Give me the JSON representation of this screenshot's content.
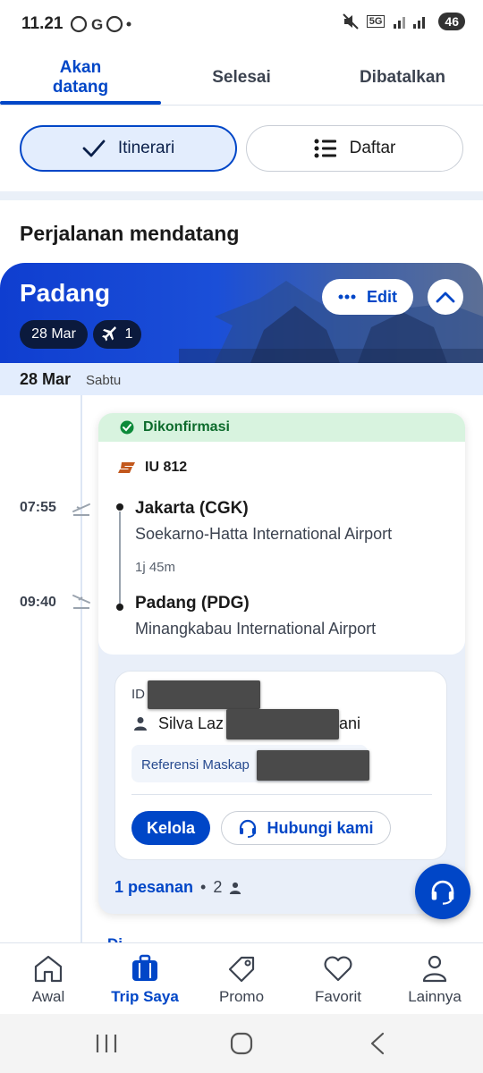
{
  "status_bar": {
    "time": "11.21",
    "left_icons": "ⓦ G ◎ •",
    "network": "5G",
    "battery": "46"
  },
  "tabs": [
    {
      "label": "Akan datang"
    },
    {
      "label": "Selesai"
    },
    {
      "label": "Dibatalkan"
    }
  ],
  "view_toggle": {
    "itinerary_label": "Itinerari",
    "list_label": "Daftar"
  },
  "section_title": "Perjalanan mendatang",
  "trip": {
    "destination": "Padang",
    "date_chip": "28 Mar",
    "flight_count": "1",
    "edit_label": "Edit",
    "date_main": "28 Mar",
    "date_day": "Sabtu"
  },
  "flight": {
    "status": "Dikonfirmasi",
    "number": "IU 812",
    "departure_time": "07:55",
    "arrival_time": "09:40",
    "origin_city": "Jakarta (CGK)",
    "origin_airport": "Soekarno-Hatta International Airport",
    "duration": "1j 45m",
    "dest_city": "Padang (PDG)",
    "dest_airport": "Minangkabau International Airport"
  },
  "booking": {
    "id_label": "ID",
    "passenger_visible": "Silva Laz",
    "passenger_suffix": "ani",
    "airline_ref_label": "Referensi Maskap",
    "manage_label": "Kelola",
    "contact_label": "Hubungi kami",
    "orders_label": "1 pesanan",
    "separator": "•",
    "pax_count": "2"
  },
  "peek_text": "Di...",
  "bottom_nav": [
    {
      "label": "Awal",
      "icon": "home-icon"
    },
    {
      "label": "Trip Saya",
      "icon": "suitcase-icon"
    },
    {
      "label": "Promo",
      "icon": "tag-icon"
    },
    {
      "label": "Favorit",
      "icon": "heart-icon"
    },
    {
      "label": "Lainnya",
      "icon": "person-icon"
    }
  ],
  "colors": {
    "brand": "#0046c7",
    "confirm_bg": "#d8f3df",
    "confirm_text": "#0d6b2c",
    "date_bar": "#e3edfd"
  }
}
